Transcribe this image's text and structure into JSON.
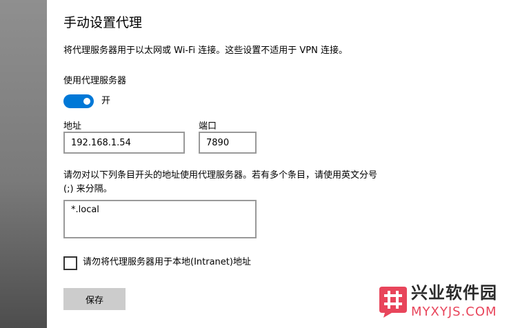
{
  "title": "手动设置代理",
  "description": "将代理服务器用于以太网或 Wi-Fi 连接。这些设置不适用于 VPN 连接。",
  "use_proxy": {
    "label": "使用代理服务器",
    "state_label": "开",
    "enabled": true
  },
  "address": {
    "label": "地址",
    "value": "192.168.1.54"
  },
  "port": {
    "label": "端口",
    "value": "7890"
  },
  "exceptions": {
    "description": "请勿对以下列条目开头的地址使用代理服务器。若有多个条目，请使用英文分号 (;) 来分隔。",
    "value": "*.local"
  },
  "bypass_local": {
    "label": "请勿将代理服务器用于本地(Intranet)地址",
    "checked": false
  },
  "save_label": "保存",
  "watermark": {
    "title": "兴业软件园",
    "url": "MYXYJS.COM"
  },
  "colors": {
    "accent": "#0078d7",
    "watermark_red": "#e8455b"
  }
}
